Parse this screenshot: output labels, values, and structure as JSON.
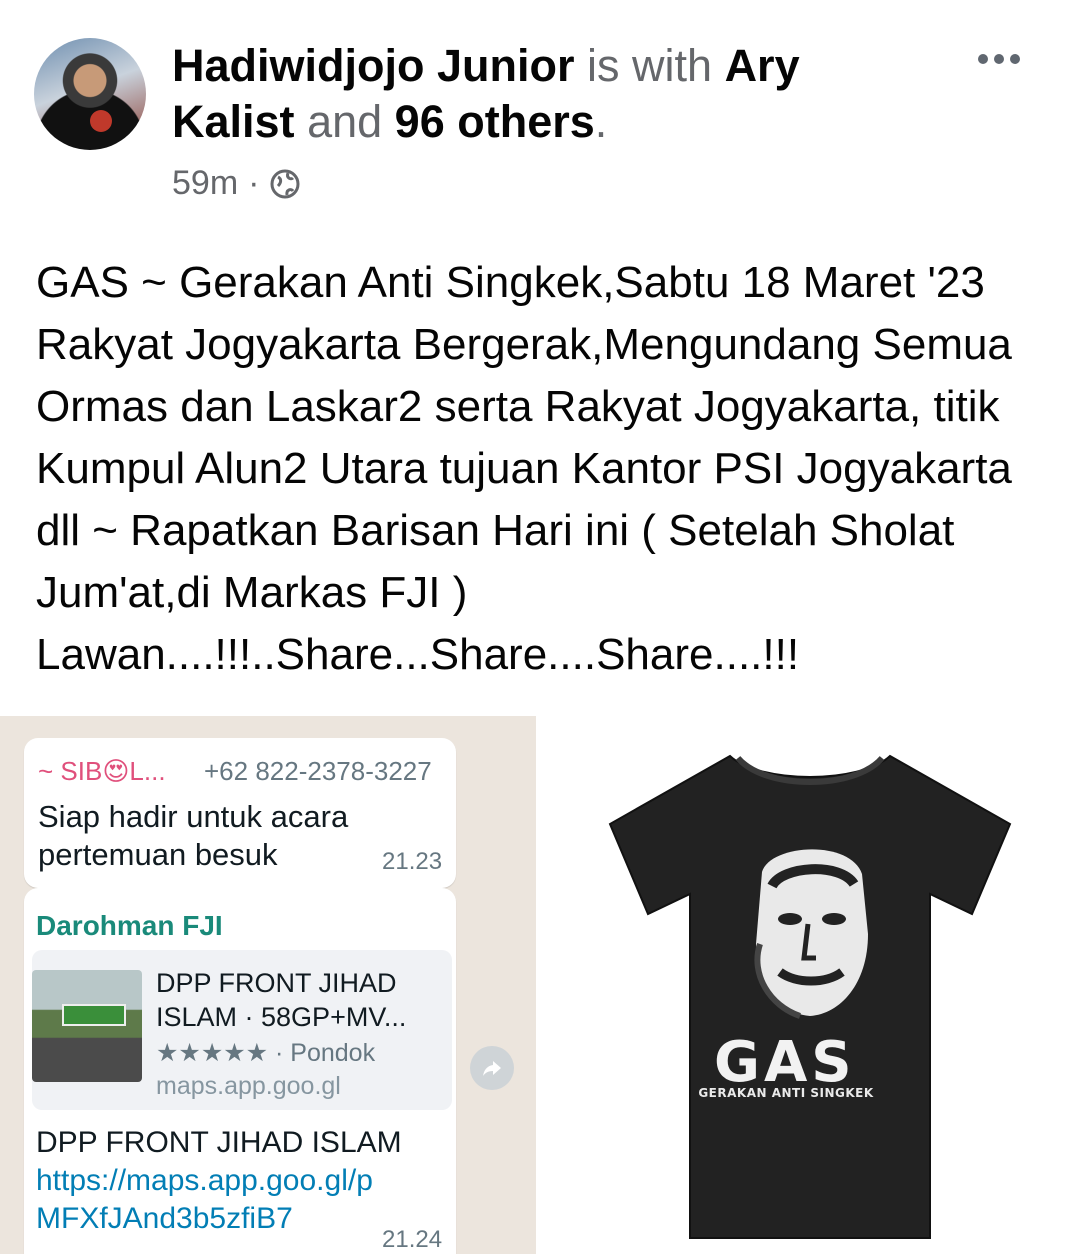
{
  "post": {
    "author": "Hadiwidjojo Junior",
    "with_text": "is with",
    "tagged_person": "Ary Kalist",
    "and_text": "and",
    "others": "96 others",
    "period": ".",
    "time": "59m",
    "separator": "·",
    "privacy_icon": "globe-icon",
    "more_icon": "more-options-icon",
    "text": "GAS ~ Gerakan Anti Singkek,Sabtu 18 Maret '23 Rakyat Jogyakarta Bergerak,Mengundang Semua Ormas dan Laskar2 serta Rakyat Jogyakarta, titik Kumpul Alun2 Utara tujuan Kantor PSI Jogyakarta dll ~ Rapatkan Barisan Hari ini ( Setelah Sholat Jum'at,di Markas FJI ) Lawan....!!!..Share...Share....Share....!!!"
  },
  "whatsapp": {
    "msg1": {
      "sender": "~ SIB😍L...",
      "phone": "+62 822-2378-3227",
      "text_line1": "Siap hadir untuk acara",
      "text_line2": "pertemuan besuk",
      "time": "21.23"
    },
    "msg2": {
      "sender": "Darohman FJI",
      "card_title": "DPP FRONT JIHAD ISLAM · 58GP+MV...",
      "card_rating": "★★★★★ · Pondok",
      "card_domain": "maps.app.goo.gl",
      "text": "DPP FRONT JIHAD ISLAM",
      "link": "https://maps.app.goo.gl/pMFXfJAnd3b5zfiB7",
      "time": "21.24"
    }
  },
  "tshirt": {
    "big_text": "GAS",
    "sub_text": "GERAKAN ANTI SINGKEK"
  }
}
